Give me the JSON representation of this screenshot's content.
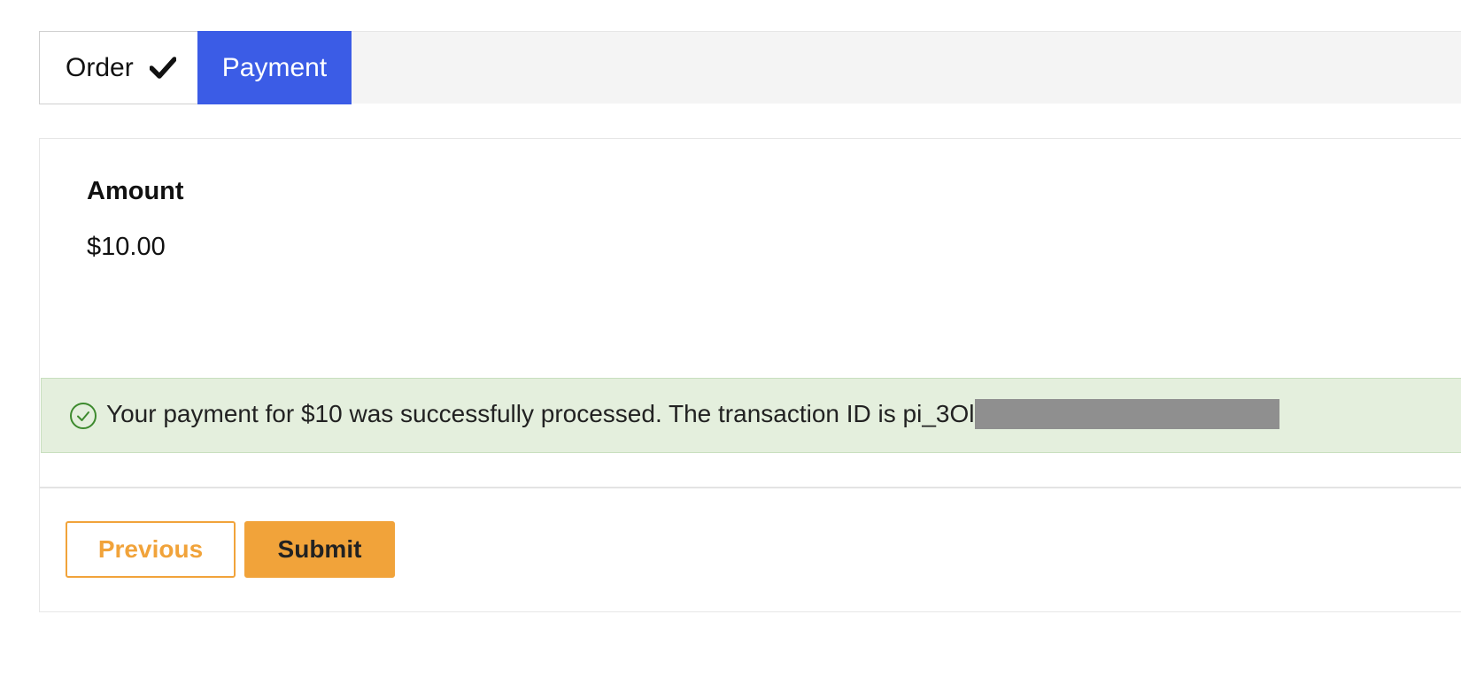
{
  "steps": [
    {
      "label": "Order",
      "status": "completed",
      "icon": "checkmark-icon"
    },
    {
      "label": "Payment",
      "status": "active"
    }
  ],
  "form": {
    "amount_label": "Amount",
    "amount_value": "$10.00"
  },
  "alert": {
    "type": "success",
    "icon": "check-circle-icon",
    "message": "Your payment for $10 was successfully processed. The transaction ID is pi_3Ol"
  },
  "actions": {
    "previous_label": "Previous",
    "submit_label": "Submit"
  },
  "colors": {
    "active_step": "#3b5ce6",
    "accent": "#f1a33a",
    "success_bg": "#e4efdd",
    "success_icon": "#3d8a2e"
  }
}
